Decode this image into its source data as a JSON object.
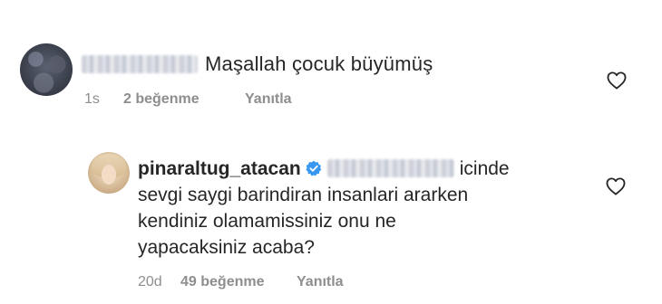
{
  "comment": {
    "text": "Maşallah çocuk büyümüş",
    "time": "1s",
    "likes": "2 beğenme",
    "reply_label": "Yanıtla"
  },
  "reply": {
    "username": "pinaraltug_atacan",
    "line1_text": "icinde",
    "line2": "sevgi saygi barindiran insanlari ararken",
    "line3": "kendiniz olamamissiniz onu ne",
    "line4": "yapacaksiniz acaba?",
    "time": "20d",
    "likes": "49 beğenme",
    "reply_label": "Yanıtla"
  },
  "icons": {
    "like": "heart-outline-icon",
    "verified": "verified-badge-icon"
  },
  "colors": {
    "text": "#262626",
    "meta": "#8e8e8e",
    "verified": "#3897f0"
  }
}
